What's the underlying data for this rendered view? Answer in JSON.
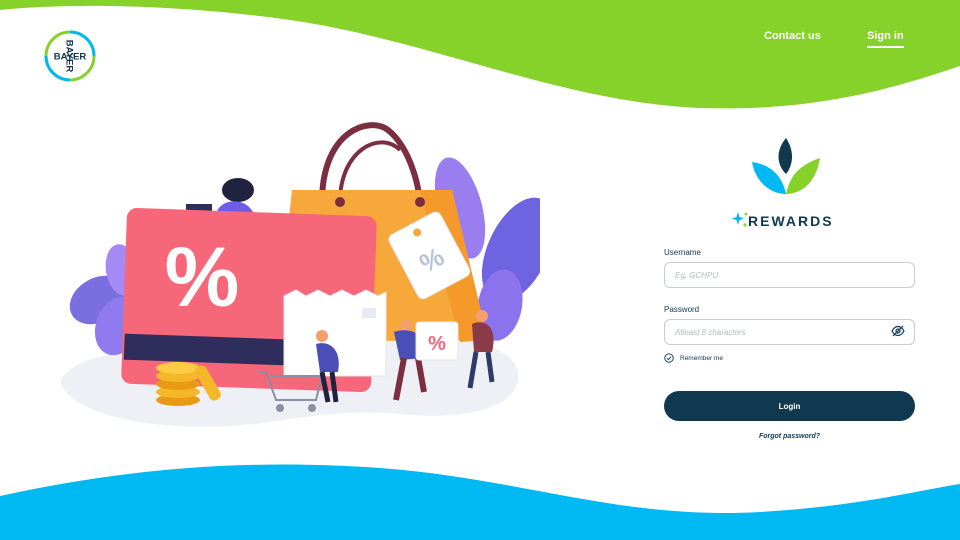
{
  "brand": {
    "logo_letters": "BAYER",
    "green": "#87d22a",
    "blue": "#00b8f2",
    "navy": "#10384f"
  },
  "header": {
    "contact_label": "Contact us",
    "signin_label": "Sign in"
  },
  "illustration": {
    "card_symbol": "%",
    "tag_symbol": "%",
    "box_symbol": "%"
  },
  "rewards": {
    "title": "REWARDS"
  },
  "form": {
    "username_label": "Username",
    "username_placeholder": "Eg. GCHPU",
    "password_label": "Password",
    "password_placeholder": "Atleast 8 characters",
    "remember_label": "Remember me",
    "login_label": "Login",
    "forgot_label": "Forgot password?"
  },
  "icons": [
    "bayer-logo-icon",
    "rewards-leaf-icon",
    "sparkle-icon",
    "eye-off-icon",
    "check-circle-icon"
  ]
}
